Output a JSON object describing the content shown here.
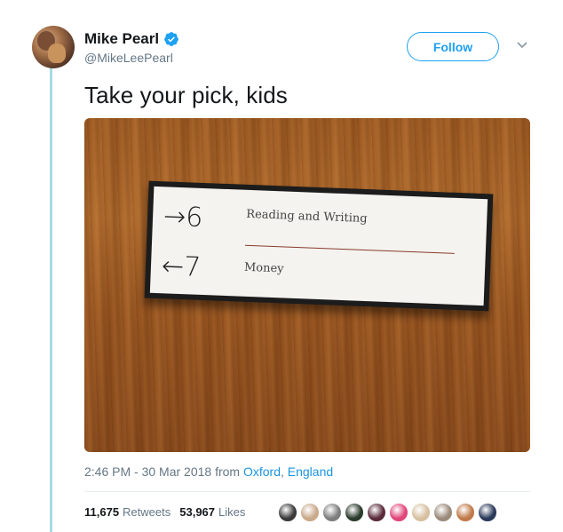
{
  "author": {
    "display_name": "Mike Pearl",
    "handle": "@MikeLeePearl",
    "verified": true
  },
  "follow_label": "Follow",
  "tweet": {
    "text": "Take your pick, kids"
  },
  "photo": {
    "sign_top_arrow": "→6",
    "sign_top_label": "Reading and Writing",
    "sign_bottom_arrow": "←7",
    "sign_bottom_label": "Money"
  },
  "meta": {
    "time": "2:46 PM - 30 Mar 2018 from ",
    "location_city": "Oxford",
    "location_sep": ", ",
    "location_country": "England"
  },
  "stats": {
    "retweets_count": "11,675",
    "retweets_label": "Retweets",
    "likes_count": "53,967",
    "likes_label": "Likes"
  },
  "colors": {
    "accent": "#1da1f2",
    "thread_line": "#a9dbe3",
    "muted": "#657786"
  },
  "likers": [
    {
      "icon": "avatar-icon",
      "color": "#3a3a3a"
    },
    {
      "icon": "avatar-icon",
      "color": "#c9a98a"
    },
    {
      "icon": "avatar-icon",
      "color": "#7d7d7d"
    },
    {
      "icon": "avatar-icon",
      "color": "#2b3a2b"
    },
    {
      "icon": "avatar-icon",
      "color": "#5a2a3a"
    },
    {
      "icon": "avatar-icon",
      "color": "#e0457a"
    },
    {
      "icon": "avatar-icon",
      "color": "#d7c0a0"
    },
    {
      "icon": "avatar-icon",
      "color": "#9a8a7a"
    },
    {
      "icon": "avatar-icon",
      "color": "#c07a4a"
    },
    {
      "icon": "avatar-icon",
      "color": "#2a3a5a"
    }
  ]
}
